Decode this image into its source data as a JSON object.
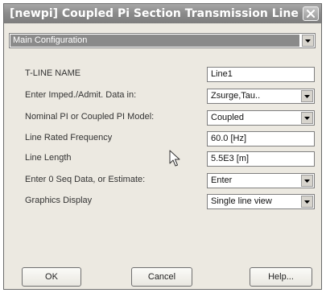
{
  "window": {
    "title": "[newpi] Coupled Pi Section Transmission Line"
  },
  "config_select": {
    "value": "Main Configuration"
  },
  "rows": [
    {
      "label": "T-LINE NAME",
      "value": "Line1",
      "type": "text"
    },
    {
      "label": "Enter Imped./Admit. Data in:",
      "value": "Zsurge,Tau..",
      "type": "select"
    },
    {
      "label": "Nominal PI or Coupled PI Model:",
      "value": "Coupled",
      "type": "select"
    },
    {
      "label": "Line Rated Frequency",
      "value": "60.0 [Hz]",
      "type": "text"
    },
    {
      "label": "Line Length",
      "value": "5.5E3 [m]",
      "type": "text"
    },
    {
      "label": "Enter 0 Seq Data, or Estimate:",
      "value": "Enter",
      "type": "select"
    },
    {
      "label": "Graphics Display",
      "value": "Single line view",
      "type": "select"
    }
  ],
  "buttons": {
    "ok": "OK",
    "cancel": "Cancel",
    "help": "Help..."
  },
  "icons": {
    "close": "close-icon",
    "dropdown": "chevron-down-icon",
    "cursor": "mouse-pointer-icon"
  },
  "colors": {
    "titlebar": "#8c8c8c",
    "dialog_bg": "#ece9e1",
    "selection": "#8a8a8a"
  }
}
